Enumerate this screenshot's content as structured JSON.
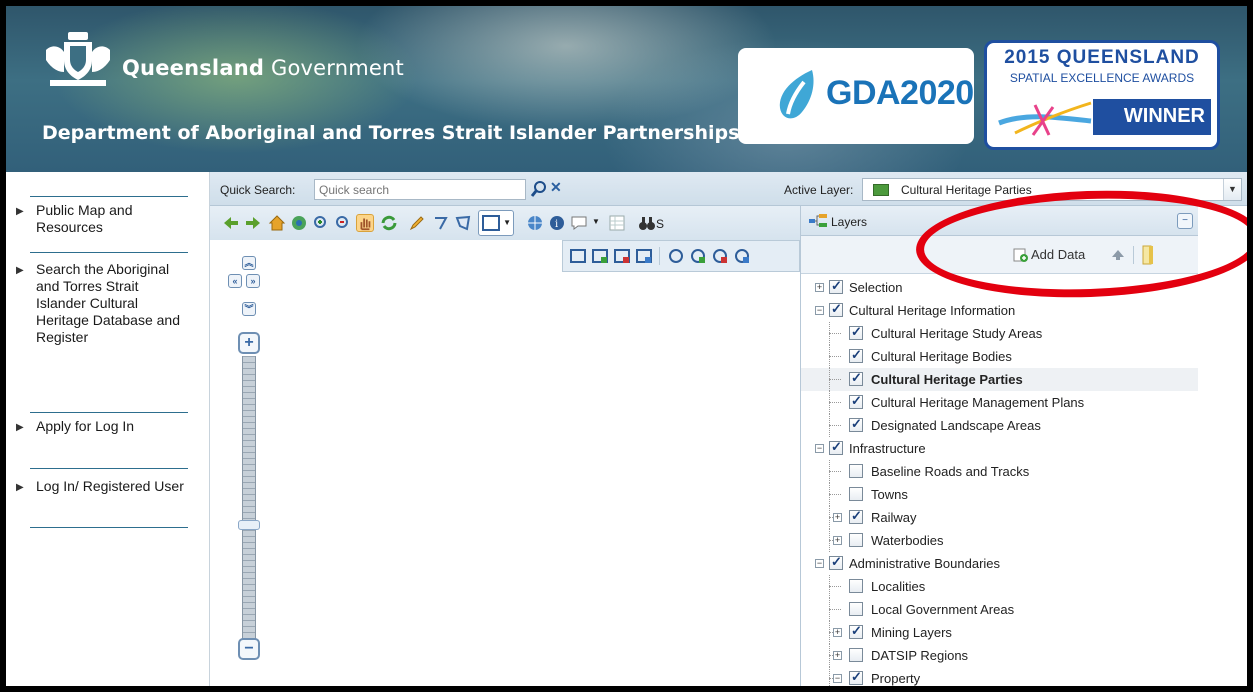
{
  "header": {
    "gov_name_bold": "Queensland",
    "gov_name_rest": " Government",
    "department": "Department of Aboriginal and Torres Strait Islander Partnerships",
    "gda_logo_text": "GDA2020",
    "award_line1": "2015 QUEENSLAND",
    "award_line2": "SPATIAL EXCELLENCE AWARDS",
    "award_line3": "WINNER"
  },
  "leftnav": {
    "items": [
      {
        "label": "Public Map and Resources"
      },
      {
        "label": "Search the Aboriginal and Torres Strait Islander Cultural Heritage Database and Register"
      },
      {
        "label": "Apply for Log In"
      },
      {
        "label": "Log In/ Registered User"
      }
    ]
  },
  "quick_search": {
    "label": "Quick Search:",
    "placeholder": "Quick search"
  },
  "active_layer": {
    "label": "Active Layer:",
    "value": "Cultural Heritage Parties",
    "swatch_color": "#4c9a3c"
  },
  "layers_panel": {
    "title": "Layers",
    "add_data_label": "Add Data",
    "tree": [
      {
        "label": "Selection",
        "checked": true,
        "level": 0,
        "expander": "plus"
      },
      {
        "label": "Cultural Heritage Information",
        "checked": true,
        "level": 0,
        "expander": "minus"
      },
      {
        "label": "Cultural Heritage Study Areas",
        "checked": true,
        "level": 1
      },
      {
        "label": "Cultural Heritage Bodies",
        "checked": true,
        "level": 1
      },
      {
        "label": "Cultural Heritage Parties",
        "checked": true,
        "level": 1,
        "selected": true
      },
      {
        "label": "Cultural Heritage Management Plans",
        "checked": true,
        "level": 1
      },
      {
        "label": "Designated Landscape Areas",
        "checked": true,
        "level": 1
      },
      {
        "label": "Infrastructure",
        "checked": true,
        "level": 0,
        "expander": "minus"
      },
      {
        "label": "Baseline Roads and Tracks",
        "checked": false,
        "level": 1
      },
      {
        "label": "Towns",
        "checked": false,
        "level": 1
      },
      {
        "label": "Railway",
        "checked": true,
        "level": 1,
        "expander": "plus"
      },
      {
        "label": "Waterbodies",
        "checked": false,
        "level": 1,
        "expander": "plus"
      },
      {
        "label": "Administrative Boundaries",
        "checked": true,
        "level": 0,
        "expander": "minus"
      },
      {
        "label": "Localities",
        "checked": false,
        "level": 1
      },
      {
        "label": "Local Government Areas",
        "checked": false,
        "level": 1
      },
      {
        "label": "Mining Layers",
        "checked": true,
        "level": 1,
        "expander": "plus"
      },
      {
        "label": "DATSIP Regions",
        "checked": false,
        "level": 1,
        "expander": "plus"
      },
      {
        "label": "Property",
        "checked": true,
        "level": 1,
        "expander": "minus"
      }
    ]
  },
  "toolbar": {
    "truncated_label": "S"
  },
  "colors": {
    "accent": "#1f4fa0",
    "annotation": "#e3000f"
  }
}
